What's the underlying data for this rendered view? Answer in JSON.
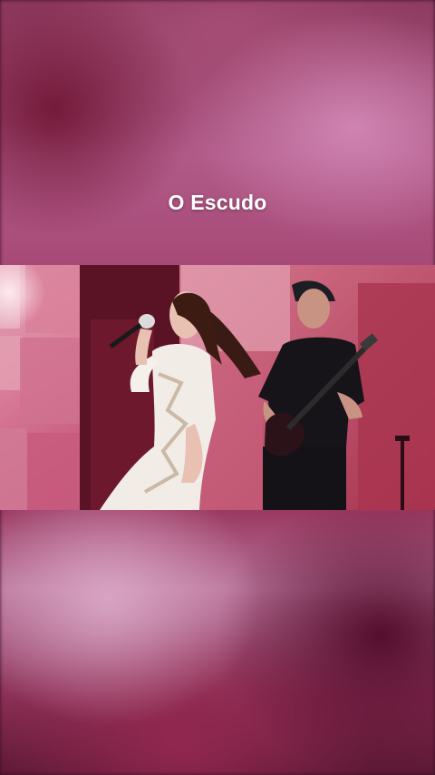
{
  "story": {
    "title": "O Escudo"
  },
  "video": {
    "description_icon": "video-frame"
  },
  "colors": {
    "backdrop_top": "#8e3b60",
    "backdrop_bottom": "#5a1834",
    "stage_pink": "#d98aa7",
    "title_text": "#ffffff"
  }
}
